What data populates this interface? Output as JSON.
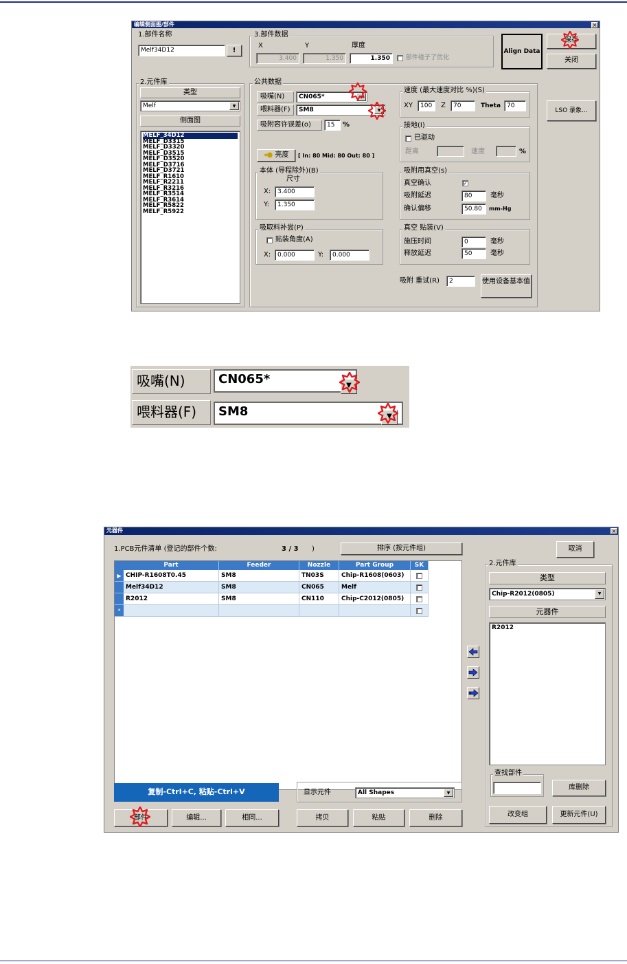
{
  "colors": {
    "rule": "#1f2f8a",
    "title_bar": "#0a246a",
    "marker": "#e0191e",
    "grid_header": "#3a7ac8",
    "copy_bar": "#1565b8"
  },
  "dialog1": {
    "title": "编辑侧面图/部件",
    "close": "×",
    "part_name": {
      "label": "1.部件名称",
      "value": "Melf34D12",
      "button": "!"
    },
    "part_data": {
      "label": "3.部件数据",
      "x_label": "X",
      "y_label": "Y",
      "thickness_label": "厚度",
      "x_value": "3.400",
      "y_value": "1.350",
      "thickness_value": "1.350",
      "optimize_label": "部件碰子了优化"
    },
    "align_data": "Align Data",
    "save": "保存",
    "close_btn": "关闭",
    "lso": "LSO 录象...",
    "library": {
      "label": "2.元件库",
      "type_header": "类型",
      "type_value": "Melf",
      "side_header": "侧面图",
      "items": [
        "MELF_34D12",
        "MELF_D3315",
        "MELF_D3320",
        "MELF_D3515",
        "MELF_D3520",
        "MELF_D3716",
        "MELF_D3721",
        "MELF_R1610",
        "MELF_R2211",
        "MELF_R3216",
        "MELF_R3514",
        "MELF_R3614",
        "MELF_R5822",
        "MELF_R5922"
      ]
    },
    "common": {
      "label": "公共数据",
      "nozzle_label": "吸嘴(N)",
      "nozzle_value": "CN065*",
      "feeder_label": "喂料器(F)",
      "feeder_value": "SM8",
      "tolerance_label": "吸附容许误差(o)",
      "tolerance_value": "15",
      "tolerance_unit": "%",
      "brightness_btn": "亮度",
      "brightness_info": "[ In: 80 Mid: 80 Out: 80 ]"
    },
    "speed": {
      "label": "速度 (最大速度对比 %)(S)",
      "xy_label": "XY",
      "xy_value": "100",
      "z_label": "Z",
      "z_value": "70",
      "theta_label": "Theta",
      "theta_value": "70"
    },
    "ground": {
      "label": "接地(I)",
      "driven_label": "已驱动",
      "distance_label": "距离",
      "speed_label": "速度",
      "unit": "%"
    },
    "body": {
      "label": "本体 (导程除外)(B)",
      "size_label": "尺寸",
      "x_label": "X:",
      "x_value": "3.400",
      "y_label": "Y:",
      "y_value": "1.350"
    },
    "vacuum": {
      "label": "吸附用真空(s)",
      "confirm_label": "真空确认",
      "confirm_checked": "✓",
      "delay_label": "吸附延迟",
      "delay_value": "80",
      "delay_unit": "毫秒",
      "offset_label": "确认偏移",
      "offset_value": "50.80",
      "offset_unit": "mm-Hg"
    },
    "pick_comp": {
      "label": "吸取料补尝(P)",
      "angle_label": "贴装角度(A)",
      "x_label": "X:",
      "x_value": "0.000",
      "y_label": "Y:",
      "y_value": "0.000"
    },
    "vac_mount": {
      "label": "真空 贴装(V)",
      "press_label": "施压时间",
      "press_value": "0",
      "press_unit": "毫秒",
      "release_label": "释放延迟",
      "release_value": "50",
      "release_unit": "毫秒"
    },
    "retry": {
      "label": "吸附 重试(R)",
      "value": "2",
      "use_default": "使用设备基本值"
    }
  },
  "zoom": {
    "nozzle_label": "吸嘴(N)",
    "nozzle_value": "CN065*",
    "feeder_label": "喂料器(F)",
    "feeder_value": "SM8"
  },
  "dialog2": {
    "title": "元器件",
    "close": "×",
    "pcb_list_label": "1.PCB元件清单  (登记的部件个数:",
    "pcb_count": "3 / 3",
    "pcb_close": ")",
    "sort_btn": "排序 (按元件组)",
    "cancel": "取消",
    "columns": [
      "Part",
      "Feeder",
      "Nozzle",
      "Part Group",
      "SK"
    ],
    "rows": [
      {
        "part": "CHIP-R1608T0.45",
        "feeder": "SM8",
        "nozzle": "TN03S",
        "group": "Chip-R1608(0603)"
      },
      {
        "part": "Melf34D12",
        "feeder": "SM8",
        "nozzle": "CN065",
        "group": "Melf"
      },
      {
        "part": "R2012",
        "feeder": "SM8",
        "nozzle": "CN110",
        "group": "Chip-C2012(0805)"
      }
    ],
    "new_row_marker": "*",
    "current_row_marker": "▶",
    "library": {
      "label": "2.元件库",
      "type_header": "类型",
      "type_value": "Chip-R2012(0805)",
      "component_header": "元器件",
      "items": [
        "R2012"
      ]
    },
    "search": {
      "label": "查找部件",
      "value": ""
    },
    "lib_delete": "库删除",
    "change_group": "改变组",
    "update_component": "更新元件(U)",
    "copy_hint": "复制-Ctrl+C, 粘贴-Ctrl+V",
    "show_label": "显示元件",
    "show_value": "All Shapes",
    "btn_part": "部件",
    "btn_edit": "编辑...",
    "btn_same": "相同...",
    "btn_copy": "拷贝",
    "btn_paste": "粘贴",
    "btn_delete": "删除"
  }
}
